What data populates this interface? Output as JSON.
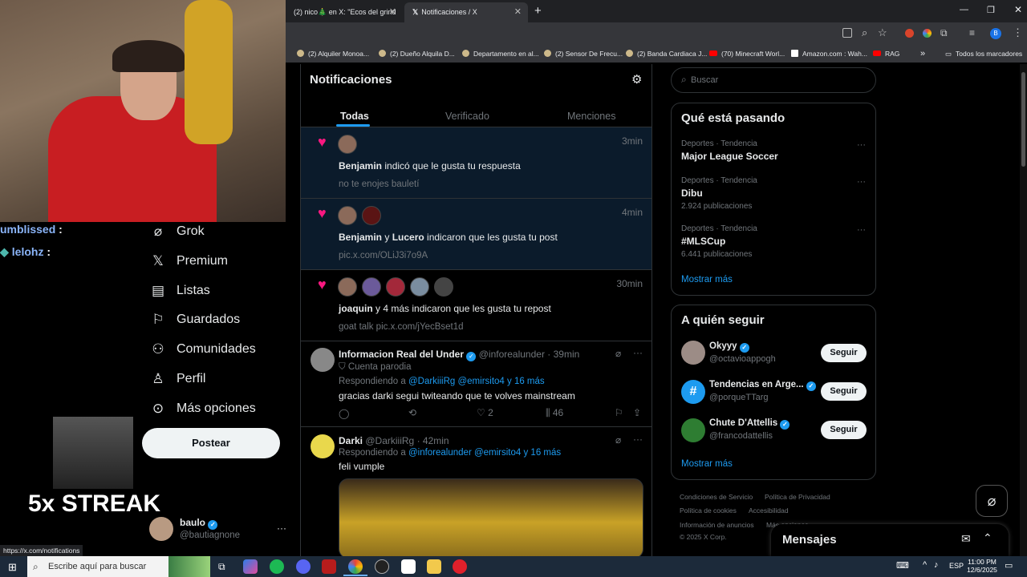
{
  "browser": {
    "tabs": [
      {
        "label": "(2) nico🎄 en X: \"Ecos del grind",
        "close": "✕"
      },
      {
        "label": "Notificaciones / X",
        "close": "✕"
      }
    ],
    "new_tab": "+",
    "bookmarks": [
      "(2) Alquiler Monoa...",
      "(2) Dueño Alquila D...",
      "Departamento en al...",
      "(2) Sensor De Frecu...",
      "(2) Banda Cardiaca J...",
      "(70) Minecraft Worl...",
      "Amazon.com : Wah...",
      "RAG"
    ],
    "bookmarks_more": "»",
    "all_bookmarks": "Todos los marcadores",
    "status_url": "https://x.com/notifications"
  },
  "stream": {
    "chat": [
      {
        "user": "umblissed",
        "sep": ":"
      },
      {
        "user": "lelohz",
        "sep": ":"
      }
    ],
    "streak": "5x STREAK"
  },
  "sidebar": {
    "items": [
      {
        "label": "Grok",
        "icon": "grok-icon"
      },
      {
        "label": "Premium",
        "icon": "x-logo-icon"
      },
      {
        "label": "Listas",
        "icon": "list-icon"
      },
      {
        "label": "Guardados",
        "icon": "bookmark-icon"
      },
      {
        "label": "Comunidades",
        "icon": "people-icon"
      },
      {
        "label": "Perfil",
        "icon": "person-icon"
      },
      {
        "label": "Más opciones",
        "icon": "more-circle-icon"
      }
    ],
    "post_button": "Postear",
    "account": {
      "name": "baulo",
      "handle": "@bautiagnone",
      "more": "···"
    }
  },
  "main": {
    "title": "Notificaciones",
    "tabs": [
      "Todas",
      "Verificado",
      "Menciones"
    ],
    "notifications": [
      {
        "time": "3min",
        "who": "Benjamin",
        "action": " indicó que le gusta tu respuesta",
        "sub": "no te enojes bauletí"
      },
      {
        "time": "4min",
        "who": "Benjamin",
        "and": " y ",
        "who2": "Lucero",
        "action": " indicaron que les gusta tu post",
        "sub": "pic.x.com/OLiJ3i7o9A"
      },
      {
        "time": "30min",
        "who": "joaquin",
        "action": " y 4 más indicaron que les gusta tu repost",
        "sub": "goat talk pic.x.com/jYecBset1d"
      }
    ],
    "post1": {
      "name": "Informacion Real del Under",
      "handle": "@inforealunder · 39min",
      "parody": "Cuenta parodia",
      "replying_prefix": "Respondiendo a ",
      "replying_users": "@DarkiiiRg @emirsito4 y 16 más",
      "text": "gracias darki segui twiteando que te volves mainstream",
      "likes": "2",
      "views": "46"
    },
    "post2": {
      "name": "Darki",
      "handle": "@DarkiiiRg · 42min",
      "replying_prefix": "Respondiendo a ",
      "replying_users": "@inforealunder @emirsito4 y 16 más",
      "text": "feli vumple"
    }
  },
  "right": {
    "search_placeholder": "Buscar",
    "trends_title": "Qué está pasando",
    "trends": [
      {
        "category": "Deportes · Tendencia",
        "name": "Major League Soccer",
        "count": ""
      },
      {
        "category": "Deportes · Tendencia",
        "name": "Dibu",
        "count": "2.924 publicaciones"
      },
      {
        "category": "Deportes · Tendencia",
        "name": "#MLSCup",
        "count": "6.441 publicaciones"
      }
    ],
    "show_more": "Mostrar más",
    "follow_title": "A quién seguir",
    "follow": [
      {
        "name": "Okyyy",
        "handle": "@octavioappogh",
        "button": "Seguir"
      },
      {
        "name": "Tendencias en Arge...",
        "handle": "@porqueTTarg",
        "button": "Seguir"
      },
      {
        "name": "Chute D'Attellis",
        "handle": "@francodattellis",
        "button": "Seguir"
      }
    ],
    "footer": [
      "Condiciones de Servicio",
      "Política de Privacidad",
      "Política de cookies",
      "Accesibilidad",
      "Información de anuncios",
      "Más opciones ···",
      "© 2025 X Corp."
    ],
    "messages": "Mensajes"
  },
  "taskbar": {
    "search_placeholder": "Escribe aquí para buscar",
    "lang": "ESP",
    "time": "11:00 PM",
    "date": "12/6/2025"
  }
}
